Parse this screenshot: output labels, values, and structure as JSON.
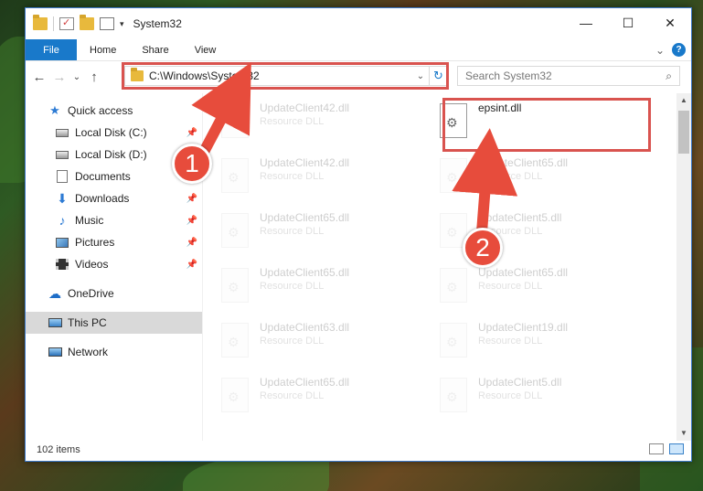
{
  "window": {
    "title": "System32",
    "controls": {
      "minimize": "—",
      "maximize": "☐",
      "close": "✕"
    }
  },
  "ribbon": {
    "tabs": [
      "File",
      "Home",
      "Share",
      "View"
    ],
    "collapse": "⌄",
    "help": "?"
  },
  "nav": {
    "back": "←",
    "forward": "→",
    "recent": "⌄",
    "up": "↑",
    "address": "C:\\Windows\\System32",
    "dropdown": "⌄",
    "refresh": "↻",
    "search_placeholder": "Search System32",
    "search_icon": "⌕"
  },
  "sidebar": {
    "items": [
      {
        "label": "Quick access",
        "icon": "star-icon",
        "glyph": "★",
        "pinned": false
      },
      {
        "label": "Local Disk (C:)",
        "icon": "disk-icon",
        "glyph": "",
        "pinned": true
      },
      {
        "label": "Local Disk (D:)",
        "icon": "disk-icon",
        "glyph": "",
        "pinned": false
      },
      {
        "label": "Documents",
        "icon": "documents-icon",
        "glyph": "",
        "pinned": false
      },
      {
        "label": "Downloads",
        "icon": "download-icon",
        "glyph": "⬇",
        "pinned": true
      },
      {
        "label": "Music",
        "icon": "music-icon",
        "glyph": "♪",
        "pinned": true
      },
      {
        "label": "Pictures",
        "icon": "pictures-icon",
        "glyph": "",
        "pinned": true
      },
      {
        "label": "Videos",
        "icon": "videos-icon",
        "glyph": "",
        "pinned": true
      },
      {
        "label": "OneDrive",
        "icon": "cloud-icon",
        "glyph": "☁",
        "pinned": false
      },
      {
        "label": "This PC",
        "icon": "pc-icon",
        "glyph": "",
        "pinned": false,
        "selected": true
      },
      {
        "label": "Network",
        "icon": "network-icon",
        "glyph": "",
        "pinned": false
      }
    ],
    "pin_glyph": "📌"
  },
  "files": {
    "left_column": [
      {
        "name": "UpdateClient42.dll",
        "type": "Resource DLL"
      },
      {
        "name": "UpdateClient42.dll",
        "type": "Resource DLL"
      },
      {
        "name": "UpdateClient65.dll",
        "type": "Resource DLL"
      },
      {
        "name": "UpdateClient65.dll",
        "type": "Resource DLL"
      },
      {
        "name": "UpdateClient63.dll",
        "type": "Resource DLL"
      },
      {
        "name": "UpdateClient65.dll",
        "type": "Resource DLL"
      }
    ],
    "right_column": [
      {
        "name": "epsint.dll",
        "type": ""
      },
      {
        "name": "UpdateClient65.dll",
        "type": "Resource DLL"
      },
      {
        "name": "UpdateClient5.dll",
        "type": "Resource DLL"
      },
      {
        "name": "UpdateClient65.dll",
        "type": "Resource DLL"
      },
      {
        "name": "UpdateClient19.dll",
        "type": "Resource DLL"
      },
      {
        "name": "UpdateClient5.dll",
        "type": "Resource DLL"
      }
    ],
    "gear_glyph": "⚙"
  },
  "status": {
    "count": "102 items"
  },
  "annotations": {
    "step1": "1",
    "step2": "2",
    "color": "#e74c3c"
  }
}
